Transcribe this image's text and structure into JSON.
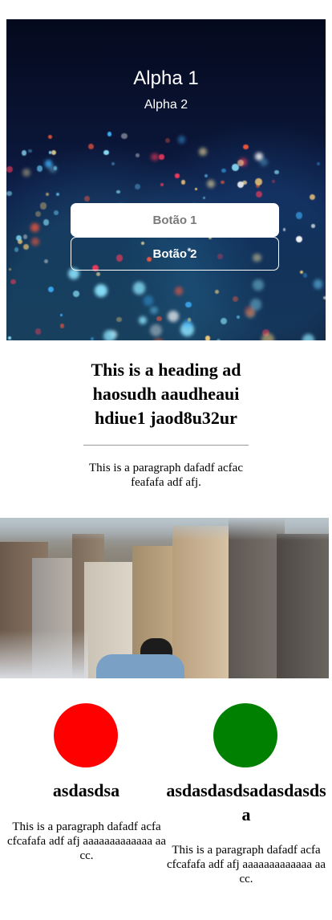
{
  "hero": {
    "title": "Alpha 1",
    "subtitle": "Alpha 2",
    "button_primary": "Botão 1",
    "button_secondary": "Botão 2"
  },
  "section": {
    "heading": "This is a heading ad haosudh aaudheaui hdiue1 jaod8u32ur",
    "paragraph": "This is a paragraph dafadf acfac feafafa adf afj."
  },
  "cards": [
    {
      "color": "#ff0000",
      "title": "asdasdsa",
      "text": "This is a paragraph dafadf acfa cfcafafa adf afj aaaaaaaaaaaaa aa cc."
    },
    {
      "color": "#008000",
      "title": "asdasdasdsadasdasdsa",
      "text": "This is a paragraph dafadf acfa cfcafafa adf afj aaaaaaaaaaaaa aa cc."
    }
  ]
}
